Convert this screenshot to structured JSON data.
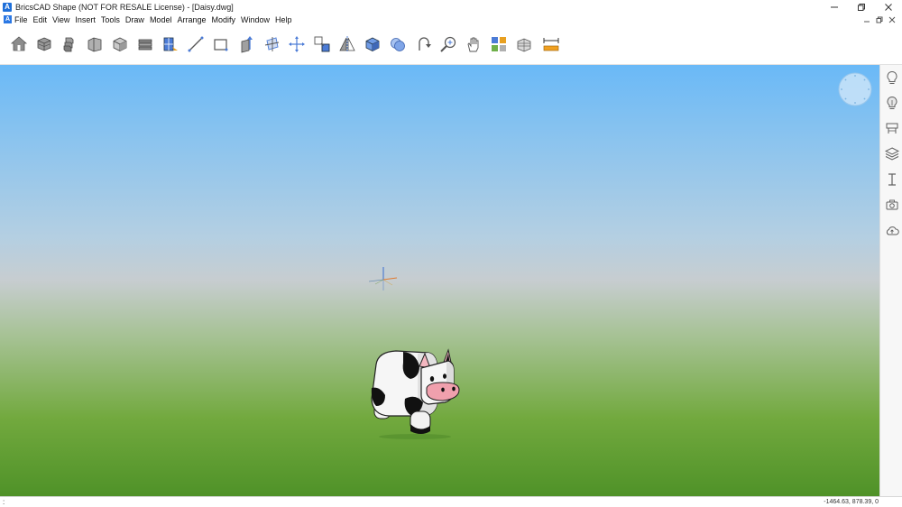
{
  "window": {
    "title": "BricsCAD Shape (NOT FOR RESALE License) - [Daisy.dwg]",
    "logo_letter": "A"
  },
  "menu": {
    "items": [
      "File",
      "Edit",
      "View",
      "Insert",
      "Tools",
      "Draw",
      "Model",
      "Arrange",
      "Modify",
      "Window",
      "Help"
    ]
  },
  "toolbar": {
    "tools": [
      "home-icon",
      "box-stack-icon",
      "layers-icon",
      "wall-icon",
      "cube-icon",
      "slab-icon",
      "window-door-icon",
      "line-icon",
      "rectangle-icon",
      "extrude-icon",
      "workplane-icon",
      "move-icon",
      "copy-icon",
      "mirror-icon",
      "solid-icon",
      "union-icon",
      "rotate-icon",
      "zoom-icon",
      "pan-icon",
      "materials-icon",
      "render-icon",
      "dimension-icon"
    ]
  },
  "sidebar": {
    "tools": [
      "lightbulb-icon",
      "light-icon",
      "components-icon",
      "layers-panel-icon",
      "text-cursor-icon",
      "camera-icon",
      "cloud-icon"
    ]
  },
  "status": {
    "left": ":",
    "coords": "-1464.63, 878.39, 0"
  },
  "colors": {
    "sky_top": "#6ab9f7",
    "horizon": "#c7cdd0",
    "ground": "#4f9228",
    "icon_blue": "#4b7bd6",
    "icon_gray": "#5f5f5f"
  }
}
